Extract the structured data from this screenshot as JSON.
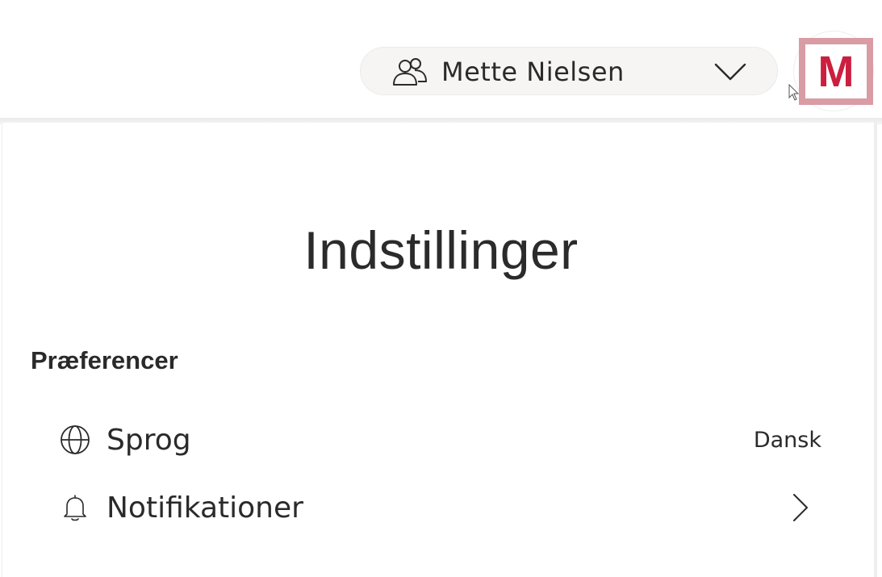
{
  "header": {
    "user_name": "Mette Nielsen",
    "logo_letter": "M",
    "icons": {
      "users": "users-icon",
      "dropdown": "chevron-down-icon",
      "cursor": "mouse-pointer-icon"
    },
    "colors": {
      "logo_red": "#cc1f3f",
      "logo_frame": "#d99ba4",
      "pill_bg": "#f6f5f3"
    }
  },
  "main": {
    "title": "Indstillinger",
    "sections": [
      {
        "title": "Præferencer",
        "items": [
          {
            "label": "Sprog",
            "value": "Dansk",
            "icon": "globe-icon"
          },
          {
            "label": "Notifikationer",
            "icon": "bell-icon",
            "trailing_icon": "chevron-right-icon"
          }
        ]
      }
    ]
  }
}
